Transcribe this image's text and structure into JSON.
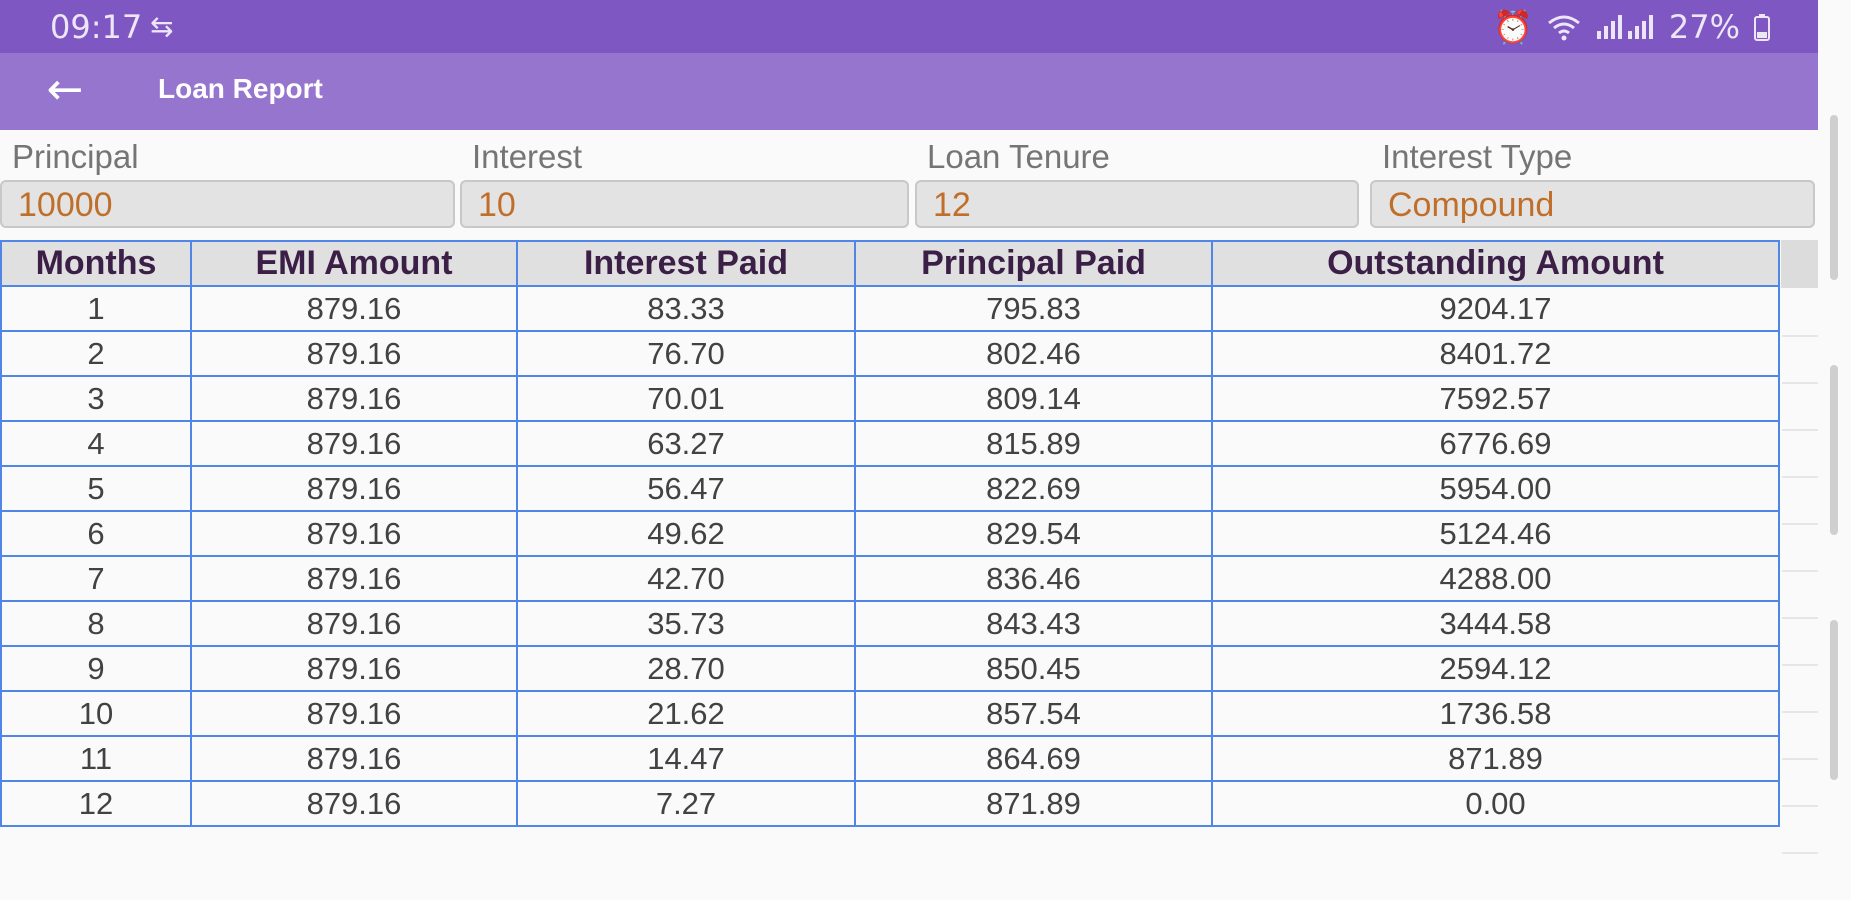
{
  "status": {
    "time": "09:17",
    "notification_icon": "sync-icon",
    "alarm_icon": "alarm-icon",
    "wifi_icon": "wifi-icon",
    "signal_icon": "signal-icon",
    "battery_text": "27%",
    "battery_icon": "battery-icon"
  },
  "appbar": {
    "title": "Loan Report",
    "back_icon": "back-arrow-icon"
  },
  "fields": {
    "principal": {
      "label": "Principal",
      "value": "10000"
    },
    "interest": {
      "label": "Interest",
      "value": "10"
    },
    "tenure": {
      "label": "Loan Tenure",
      "value": "12"
    },
    "type": {
      "label": "Interest Type",
      "value": "Compound"
    }
  },
  "table": {
    "headers": [
      "Months",
      "EMI Amount",
      "Interest Paid",
      "Principal Paid",
      "Outstanding Amount"
    ],
    "rows": [
      [
        "1",
        "879.16",
        "83.33",
        "795.83",
        "9204.17"
      ],
      [
        "2",
        "879.16",
        "76.70",
        "802.46",
        "8401.72"
      ],
      [
        "3",
        "879.16",
        "70.01",
        "809.14",
        "7592.57"
      ],
      [
        "4",
        "879.16",
        "63.27",
        "815.89",
        "6776.69"
      ],
      [
        "5",
        "879.16",
        "56.47",
        "822.69",
        "5954.00"
      ],
      [
        "6",
        "879.16",
        "49.62",
        "829.54",
        "5124.46"
      ],
      [
        "7",
        "879.16",
        "42.70",
        "836.46",
        "4288.00"
      ],
      [
        "8",
        "879.16",
        "35.73",
        "843.43",
        "3444.58"
      ],
      [
        "9",
        "879.16",
        "28.70",
        "850.45",
        "2594.12"
      ],
      [
        "10",
        "879.16",
        "21.62",
        "857.54",
        "1736.58"
      ],
      [
        "11",
        "879.16",
        "14.47",
        "864.69",
        "871.89"
      ],
      [
        "12",
        "879.16",
        "7.27",
        "871.89",
        "0.00"
      ]
    ]
  },
  "colors": {
    "status_bar": "#7e57c2",
    "app_bar": "#9575cd",
    "table_border": "#4f86e8",
    "field_value": "#c06f2b"
  }
}
